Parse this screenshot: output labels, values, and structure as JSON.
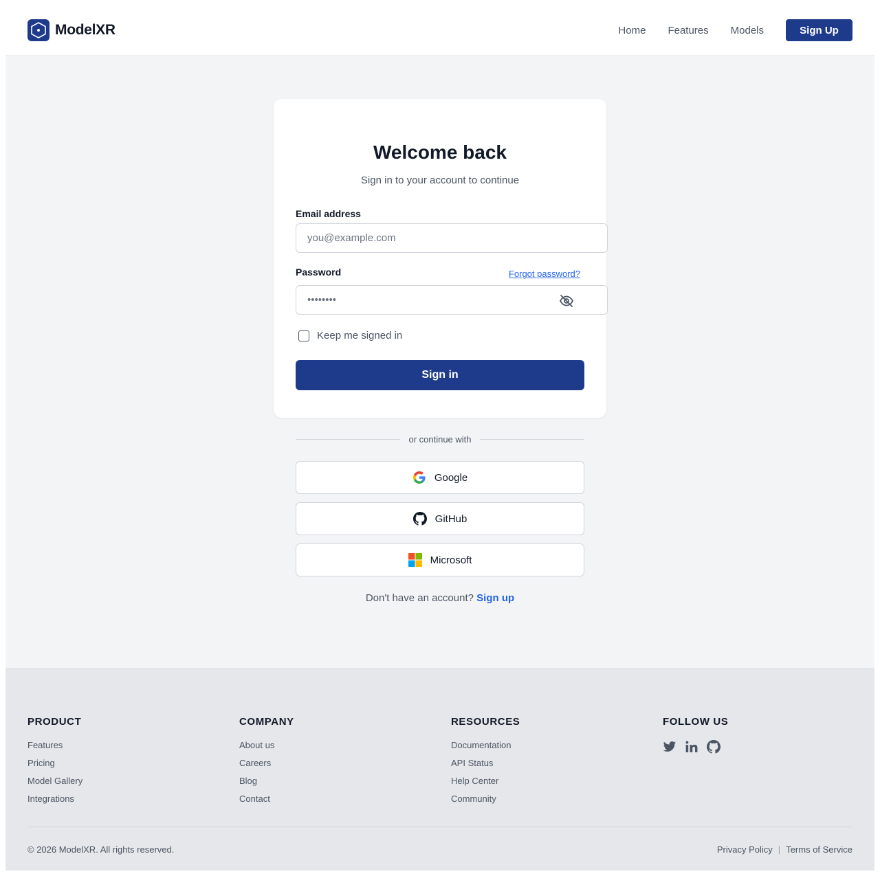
{
  "header": {
    "brand": "ModelXR",
    "nav": [
      {
        "label": "Home"
      },
      {
        "label": "Features"
      },
      {
        "label": "Models"
      }
    ],
    "signup_label": "Sign Up"
  },
  "login": {
    "title": "Welcome back",
    "subtitle": "Sign in to your account to continue",
    "email_label": "Email address",
    "email_placeholder": "you@example.com",
    "password_label": "Password",
    "forgot_label": "Forgot password?",
    "password_value": "••••••••",
    "remember_label": "Keep me signed in",
    "remember_checked": false,
    "signin_label": "Sign in"
  },
  "divider_text": "or continue with",
  "social_login": [
    {
      "label": "Google",
      "icon": "google-icon"
    },
    {
      "label": "GitHub",
      "icon": "github-icon"
    },
    {
      "label": "Microsoft",
      "icon": "microsoft-icon"
    }
  ],
  "signup_prompt": {
    "text": "Don't have an account?",
    "link": "Sign up"
  },
  "footer": {
    "columns": [
      {
        "title": "PRODUCT",
        "links": [
          "Features",
          "Pricing",
          "Model Gallery",
          "Integrations"
        ]
      },
      {
        "title": "COMPANY",
        "links": [
          "About us",
          "Careers",
          "Blog",
          "Contact"
        ]
      },
      {
        "title": "RESOURCES",
        "links": [
          "Documentation",
          "API Status",
          "Help Center",
          "Community"
        ]
      }
    ],
    "follow_title": "FOLLOW US",
    "follow_icons": [
      "twitter-icon",
      "linkedin-icon",
      "github-icon"
    ],
    "copyright": "© 2026 ModelXR. All rights reserved.",
    "privacy": "Privacy Policy",
    "separator": "|",
    "terms": "Terms of Service"
  },
  "colors": {
    "primary": "#1e3a8a",
    "link": "#2563eb",
    "background": "#f3f4f6",
    "footer_bg": "#e5e7eb"
  }
}
